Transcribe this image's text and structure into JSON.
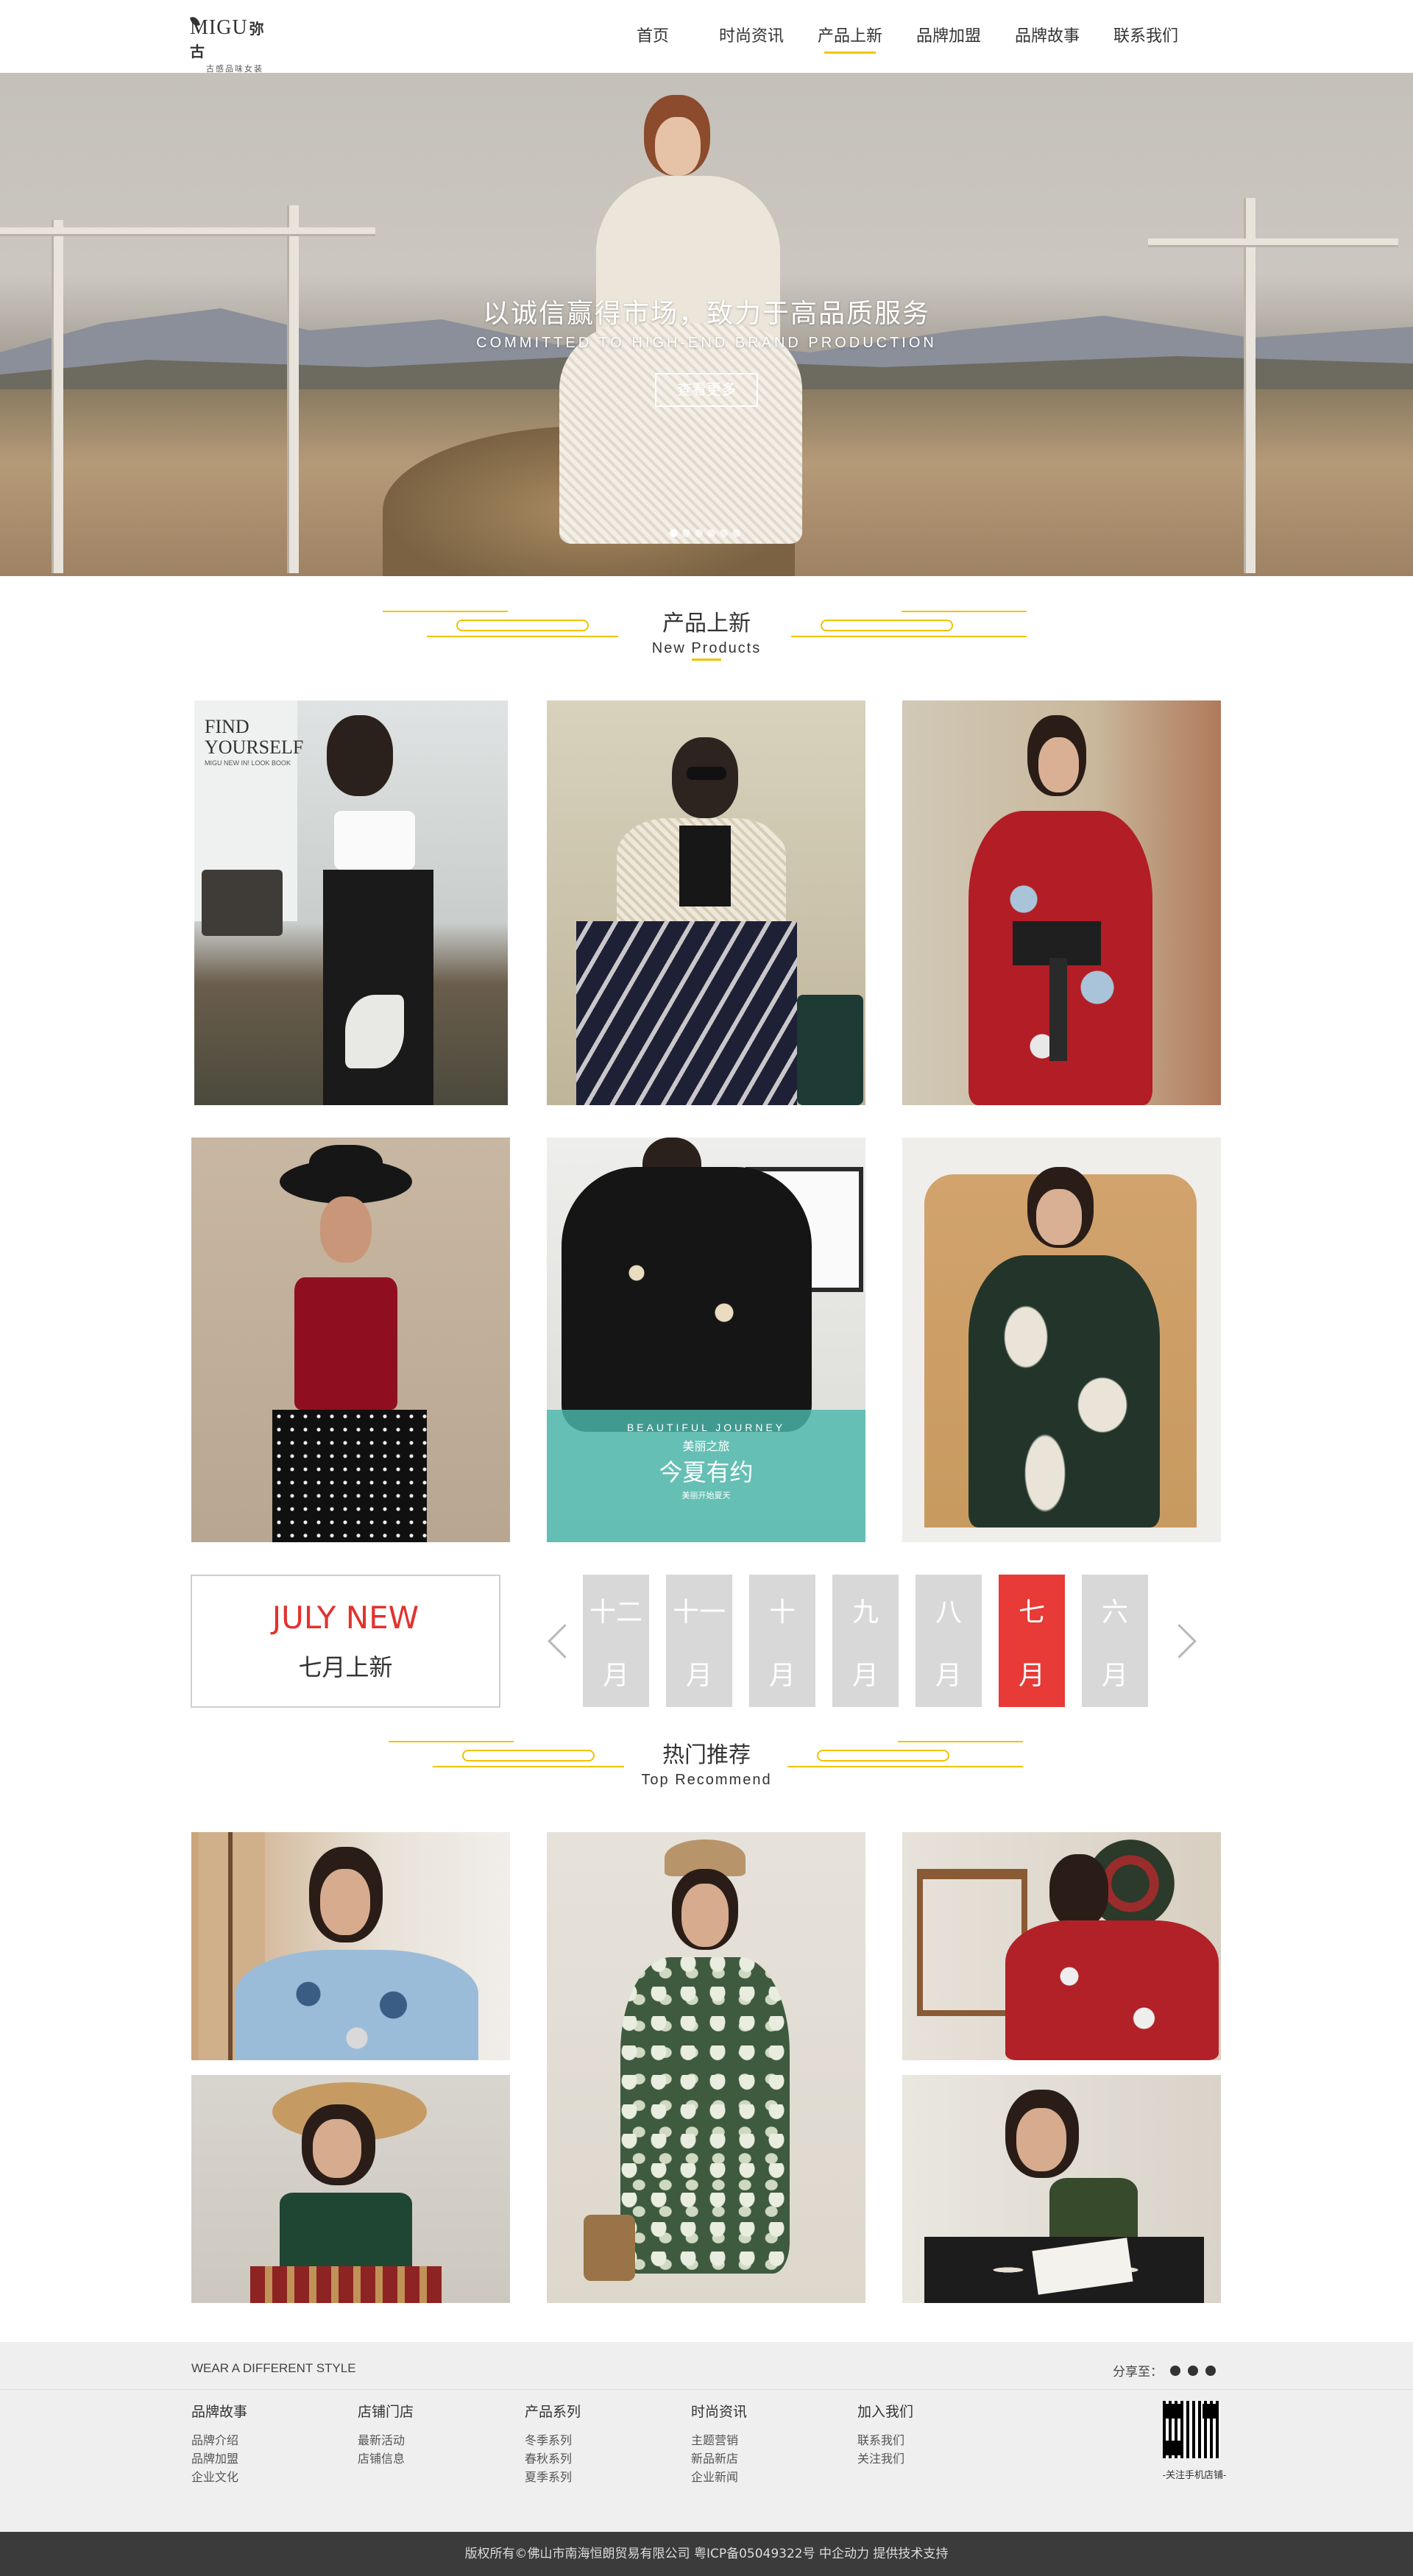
{
  "header": {
    "logo_brand": "MIGU",
    "logo_brand_cn": "弥古",
    "logo_tagline": "古感品味女装",
    "nav": [
      {
        "label": "首页"
      },
      {
        "label": "时尚资讯"
      },
      {
        "label": "产品上新",
        "active": true
      },
      {
        "label": "品牌加盟"
      },
      {
        "label": "品牌故事"
      },
      {
        "label": "联系我们"
      }
    ]
  },
  "banner": {
    "title": "以诚信赢得市场，致力于高品质服务",
    "subtitle": "COMMITTED TO HIGH-END BRAND PRODUCTION",
    "button_label": "查看更多",
    "slide_count": 6,
    "active_slide": 0
  },
  "new_products": {
    "title_cn": "产品上新",
    "title_en": "New Products",
    "items": [
      {
        "overlay_title": "FIND YOURSELF",
        "overlay_sub": "MIGU NEW IN! LOOK BOOK"
      },
      {},
      {},
      {},
      {
        "overlay_en": "BEAUTIFUL JOURNEY",
        "overlay_cn1": "美丽之旅",
        "overlay_cn2": "今夏有约",
        "overlay_cn3": "美丽开始夏天"
      },
      {}
    ]
  },
  "month_selector": {
    "box_en": "JULY NEW",
    "box_cn": "七月上新",
    "months": [
      {
        "top": "十二",
        "bottom": "月"
      },
      {
        "top": "十一",
        "bottom": "月"
      },
      {
        "top": "十",
        "bottom": "月"
      },
      {
        "top": "九",
        "bottom": "月"
      },
      {
        "top": "八",
        "bottom": "月"
      },
      {
        "top": "七",
        "bottom": "月",
        "active": true
      },
      {
        "top": "六",
        "bottom": "月"
      }
    ],
    "accent": "#e83a36"
  },
  "recommend": {
    "title_cn": "热门推荐",
    "title_en": "Top Recommend"
  },
  "footer": {
    "slogan": "WEAR A DIFFERENT STYLE",
    "share_label": "分享至：",
    "columns": [
      {
        "title": "品牌故事",
        "links": [
          "品牌介绍",
          "品牌加盟",
          "企业文化"
        ]
      },
      {
        "title": "店铺门店",
        "links": [
          "最新活动",
          "店铺信息"
        ]
      },
      {
        "title": "产品系列",
        "links": [
          "冬季系列",
          "春秋系列",
          "夏季系列"
        ]
      },
      {
        "title": "时尚资讯",
        "links": [
          "主题营销",
          "新品新店",
          "企业新闻"
        ]
      },
      {
        "title": "加入我们",
        "links": [
          "联系我们",
          "关注我们"
        ]
      }
    ],
    "qr_label": "-关注手机店铺-",
    "copyright": "版权所有©佛山市南海恒朗贸易有限公司    粤ICP备05049322号    中企动力 提供技术支持"
  },
  "colors": {
    "accent_yellow": "#f2c200",
    "accent_red": "#e83a36",
    "footer_bg": "#efefef",
    "copyright_bg": "#3b3b3b"
  }
}
